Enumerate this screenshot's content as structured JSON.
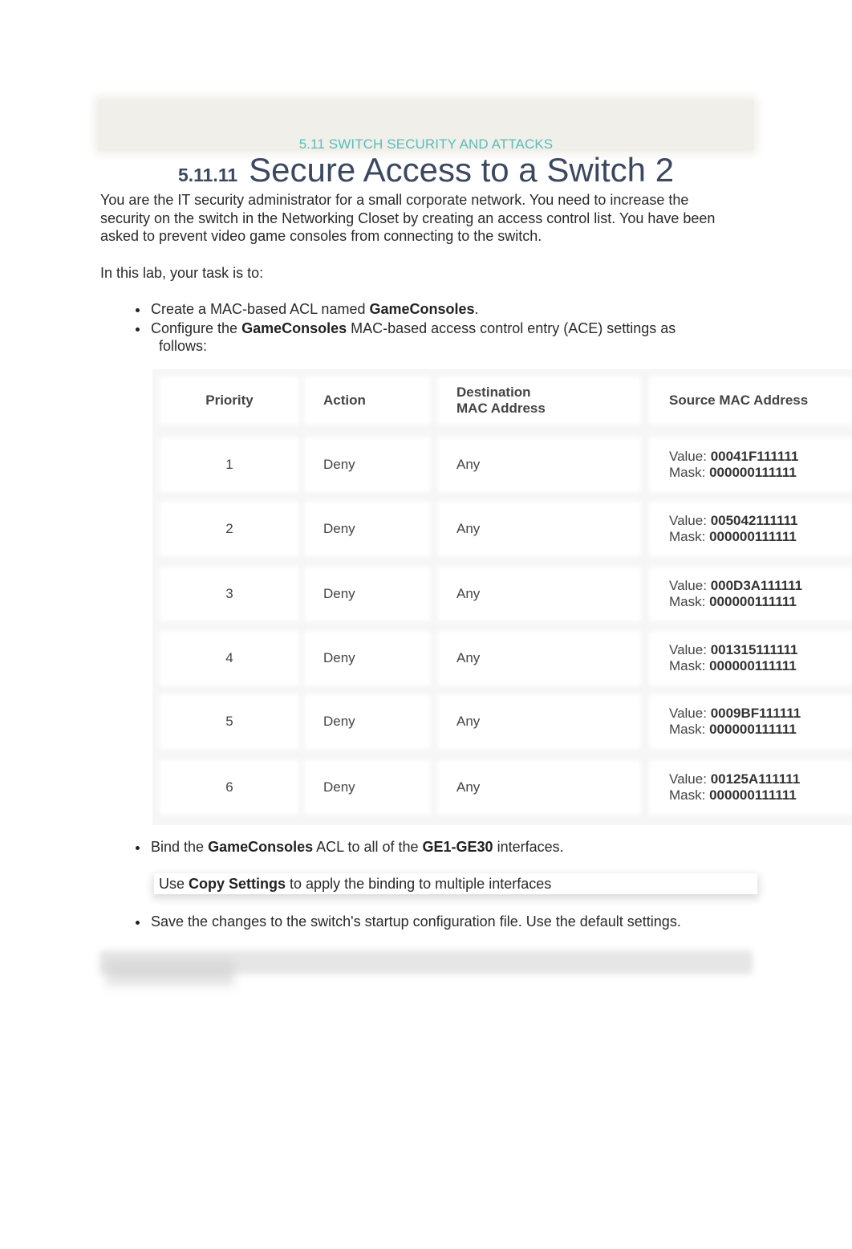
{
  "section_label": "5.11 SWITCH SECURITY AND ATTACKS",
  "title": {
    "number": "5.11.11",
    "text": "Secure Access to a Switch 2"
  },
  "intro": "You are the IT security administrator for a small corporate network. You need to increase the security on the switch in the Networking Closet by creating an access control list. You have been asked to prevent video game consoles from connecting to the switch.",
  "task_lead": "In this lab, your task is to:",
  "tasks": {
    "t1": {
      "pre": "Create a MAC-based ACL named ",
      "bold": "GameConsoles",
      "post": "."
    },
    "t2": {
      "pre": "Configure the ",
      "bold": "GameConsoles",
      "post": " MAC-based access control entry (ACE) settings as",
      "cont": "follows:"
    },
    "t3": {
      "pre": "Bind the ",
      "bold1": "GameConsoles",
      "mid": " ACL to all of the ",
      "bold2": "GE1-GE30",
      "post": " interfaces."
    },
    "tip": {
      "pre": "Use ",
      "bold": "Copy Settings",
      "post": " to apply the binding to multiple interfaces"
    },
    "t4": {
      "text": "Save the changes to the switch's startup configuration file. Use the default settings."
    }
  },
  "table": {
    "headers": {
      "priority": "Priority",
      "action": "Action",
      "dest_line1": "Destination",
      "dest_line2": "MAC Address",
      "source": "Source MAC Address"
    },
    "value_label": "Value:",
    "mask_label": "Mask:",
    "rows": [
      {
        "priority": "1",
        "action": "Deny",
        "dest": "Any",
        "value": "00041F111111",
        "mask": "000000111111"
      },
      {
        "priority": "2",
        "action": "Deny",
        "dest": "Any",
        "value": "005042111111",
        "mask": "000000111111"
      },
      {
        "priority": "3",
        "action": "Deny",
        "dest": "Any",
        "value": "000D3A111111",
        "mask": "000000111111"
      },
      {
        "priority": "4",
        "action": "Deny",
        "dest": "Any",
        "value": "001315111111",
        "mask": "000000111111"
      },
      {
        "priority": "5",
        "action": "Deny",
        "dest": "Any",
        "value": "0009BF111111",
        "mask": "000000111111"
      },
      {
        "priority": "6",
        "action": "Deny",
        "dest": "Any",
        "value": "00125A111111",
        "mask": "000000111111"
      }
    ]
  },
  "colors": {
    "section_label": "#5bbcb8",
    "title": "#3b4860",
    "table_header": "#f26c0d"
  }
}
